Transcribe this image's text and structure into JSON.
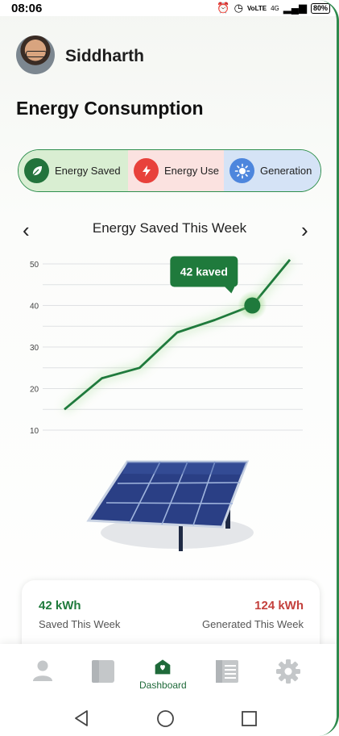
{
  "status_bar": {
    "time": "08:06",
    "network": "VoLTE",
    "signal_type": "4G",
    "battery": "80%"
  },
  "user": {
    "name": "Siddharth"
  },
  "page_title": "Energy Consumption",
  "tabs": [
    {
      "label": "Energy Saved",
      "icon": "leaf-icon",
      "color": "#d9eed2",
      "active": true
    },
    {
      "label": "Energy Use",
      "icon": "lightning-icon",
      "color": "#fbe2e0",
      "active": false
    },
    {
      "label": "Generation",
      "icon": "sun-icon",
      "color": "#d5e3f6",
      "active": false
    }
  ],
  "chart_title": "Energy Saved This Week",
  "chart_data": {
    "type": "line",
    "title": "Energy Saved This Week",
    "xlabel": "",
    "ylabel": "",
    "y_ticks": [
      50,
      40,
      30,
      20,
      10
    ],
    "series": [
      {
        "values": [
          15,
          22.5,
          25,
          33.5,
          36.5,
          40,
          51
        ]
      }
    ],
    "highlight": {
      "index": 5,
      "label": "42 kaved"
    },
    "color": "#1f7a3c",
    "grid": true
  },
  "summary": {
    "saved_value": "42 kWh",
    "saved_label": "Saved This Week",
    "generated_value": "124 kWh",
    "generated_label": "Generated This Week"
  },
  "bottom_nav": {
    "items": [
      {
        "name": "profile",
        "icon": "person-icon",
        "label": ""
      },
      {
        "name": "reports",
        "icon": "panel-icon",
        "label": ""
      },
      {
        "name": "dashboard",
        "icon": "home-icon",
        "label": "Dashboard",
        "active": true
      },
      {
        "name": "list",
        "icon": "list-icon",
        "label": ""
      },
      {
        "name": "settings",
        "icon": "gear-icon",
        "label": ""
      }
    ]
  },
  "colors": {
    "accent": "#1f7a3c",
    "danger": "#c4413d",
    "frame": "#2e8a4d"
  }
}
